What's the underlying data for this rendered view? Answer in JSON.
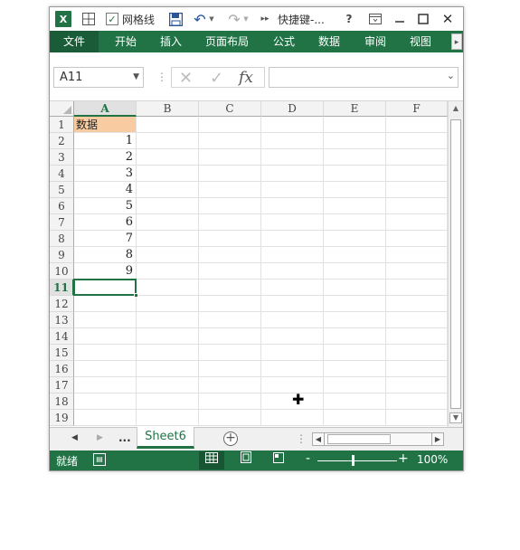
{
  "app": {
    "title": "快捷键-...",
    "logo_letter": "X",
    "gridlines_label": "网格线",
    "gridlines_checked": true,
    "accent_color": "#217346"
  },
  "qat_icons": [
    "excel-logo-icon",
    "table-icon",
    "checkbox-icon",
    "save-icon",
    "undo-icon",
    "redo-icon",
    "more-icon",
    "help-icon",
    "ribbon-options-icon",
    "minimize-icon",
    "maximize-icon",
    "close-icon"
  ],
  "ribbon": {
    "tabs": [
      "文件",
      "开始",
      "插入",
      "页面布局",
      "公式",
      "数据",
      "审阅",
      "视图"
    ]
  },
  "formula_bar": {
    "name_box": "A11",
    "formula": ""
  },
  "grid": {
    "columns": [
      "A",
      "B",
      "C",
      "D",
      "E",
      "F"
    ],
    "rows": [
      "1",
      "2",
      "3",
      "4",
      "5",
      "6",
      "7",
      "8",
      "9",
      "10",
      "11",
      "12",
      "13",
      "14",
      "15",
      "16",
      "17",
      "18",
      "19"
    ],
    "selected_column": "A",
    "selected_row": "11",
    "col_a_values": [
      "数据",
      "1",
      "2",
      "3",
      "4",
      "5",
      "6",
      "7",
      "8",
      "9",
      "",
      "",
      "",
      "",
      "",
      "",
      "",
      "",
      ""
    ],
    "header_fill": "#f8cba0"
  },
  "sheets": {
    "tabs": [
      "Sheet6"
    ],
    "ellipsis": "..."
  },
  "status": {
    "text": "就绪",
    "zoom": "100%",
    "zoom_minus": "-",
    "zoom_plus": "+"
  }
}
